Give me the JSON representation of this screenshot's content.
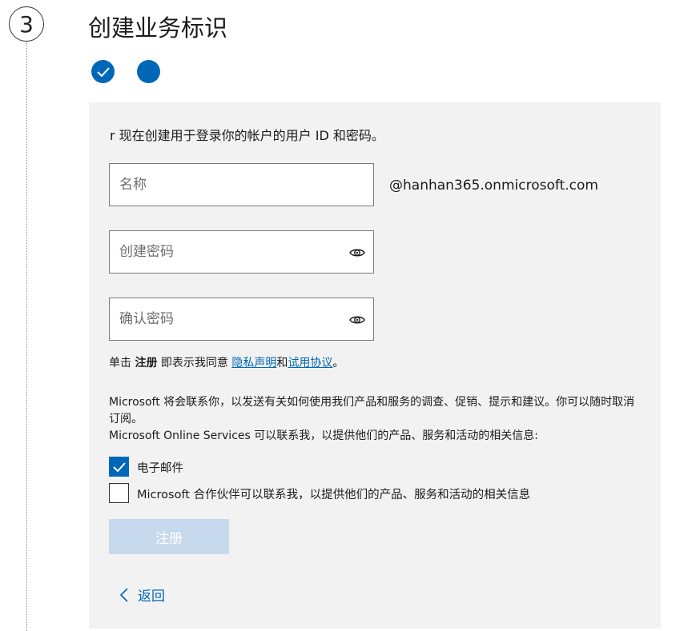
{
  "step": {
    "number": "3"
  },
  "page": {
    "title": "创建业务标识"
  },
  "progress": {
    "steps": [
      {
        "state": "done",
        "icon": "check-icon"
      },
      {
        "state": "current",
        "icon": "dot"
      }
    ],
    "accent": "#0067b8"
  },
  "form": {
    "intro": "r 现在创建用于登录你的帐户的用户 ID 和密码。",
    "username": {
      "placeholder": "名称",
      "value": ""
    },
    "domain_suffix": "@hanhan365.onmicrosoft.com",
    "password": {
      "placeholder": "创建密码",
      "value": "",
      "icon": "eye-icon"
    },
    "confirm_password": {
      "placeholder": "确认密码",
      "value": "",
      "icon": "eye-icon"
    },
    "terms": {
      "prefix": "单击 ",
      "action": "注册",
      "middle": " 即表示我同意 ",
      "privacy_link": "隐私声明",
      "conjunction": "和",
      "trial_link": "试用协议",
      "suffix": "。"
    },
    "contact_text_1": "Microsoft 将会联系你，以发送有关如何使用我们产品和服务的调查、促销、提示和建议。你可以随时取消订阅。",
    "contact_text_2": "Microsoft Online Services 可以联系我，以提供他们的产品、服务和活动的相关信息:",
    "email_checkbox": {
      "label": "电子邮件",
      "checked": true
    },
    "partner_checkbox": {
      "label": "Microsoft 合作伙伴可以联系我，以提供他们的产品、服务和活动的相关信息",
      "checked": false
    },
    "submit_label": "注册",
    "back_label": "返回"
  },
  "colors": {
    "accent": "#0067b8",
    "panel_bg": "#f2f2f2",
    "disabled_button": "#c7d9ec"
  }
}
